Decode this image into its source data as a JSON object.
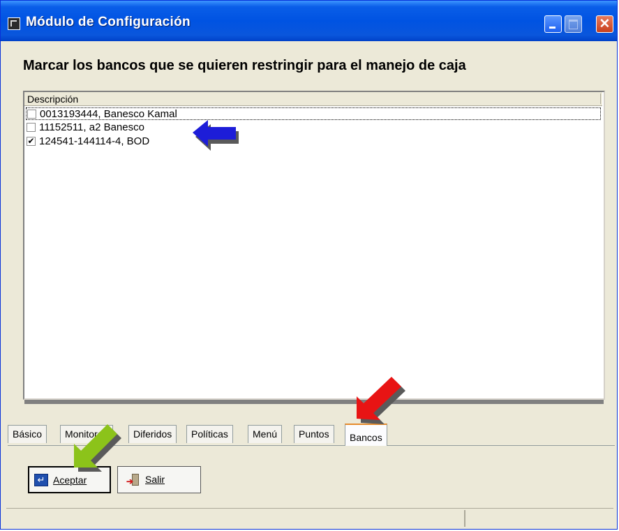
{
  "window": {
    "title": "Módulo de Configuración"
  },
  "heading": "Marcar los bancos que se quieren restringir para el manejo de caja",
  "list": {
    "column_header": "Descripción",
    "rows": [
      {
        "label": "0013193444, Banesco Kamal",
        "checked": false
      },
      {
        "label": "11152511, a2 Banesco",
        "checked": false
      },
      {
        "label": "124541-144114-4, BOD",
        "checked": true
      }
    ]
  },
  "tabs": [
    {
      "label": "Básico"
    },
    {
      "label": "Monitoreo"
    },
    {
      "label": "Diferidos"
    },
    {
      "label": "Políticas"
    },
    {
      "label": "Menú"
    },
    {
      "label": "Puntos"
    },
    {
      "label": "Bancos",
      "active": true
    }
  ],
  "buttons": {
    "accept": "Aceptar",
    "exit": "Salir"
  },
  "colors": {
    "annotation_blue": "#1d1dd8",
    "annotation_red": "#e81414",
    "annotation_green": "#8cc31a"
  }
}
